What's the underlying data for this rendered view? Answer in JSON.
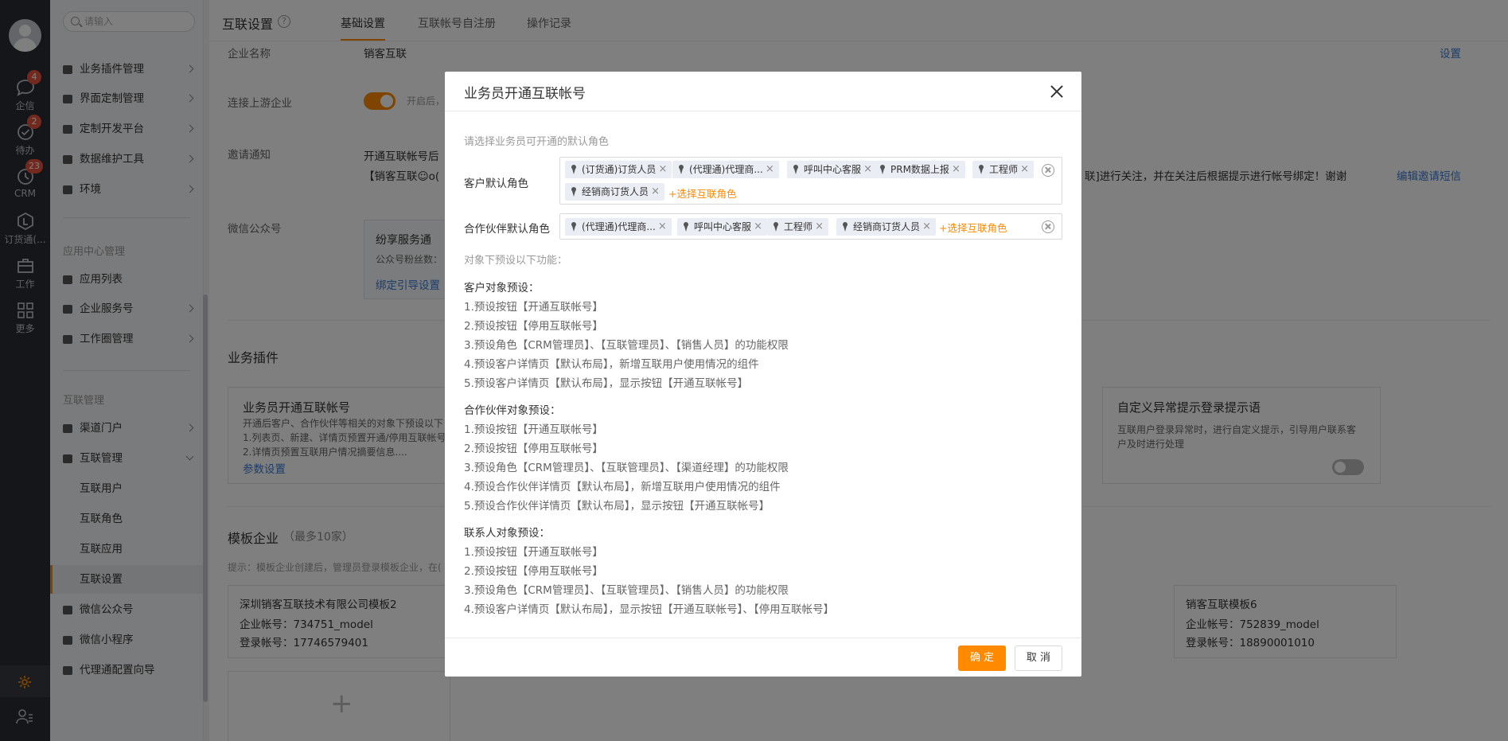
{
  "rail": {
    "items": [
      {
        "label": "企信",
        "badge": "4"
      },
      {
        "label": "待办",
        "badge": "2"
      },
      {
        "label": "CRM",
        "badge": "23"
      },
      {
        "label": "订货通(...",
        "badge": ""
      },
      {
        "label": "工作",
        "badge": ""
      },
      {
        "label": "更多",
        "badge": ""
      }
    ]
  },
  "sidebar": {
    "search_placeholder": "请输入",
    "items": [
      {
        "label": "业务插件管理"
      },
      {
        "label": "界面定制管理"
      },
      {
        "label": "定制开发平台"
      },
      {
        "label": "数据维护工具"
      },
      {
        "label": "环境"
      }
    ],
    "group_app": "应用中心管理",
    "app_items": [
      {
        "label": "应用列表"
      },
      {
        "label": "企业服务号"
      },
      {
        "label": "工作圈管理"
      }
    ],
    "group_interconnect": "互联管理",
    "ic_items": [
      {
        "label": "渠道门户"
      },
      {
        "label": "互联管理"
      }
    ],
    "ic_sub_items": [
      {
        "label": "互联用户"
      },
      {
        "label": "互联角色"
      },
      {
        "label": "互联应用"
      },
      {
        "label": "互联设置"
      }
    ],
    "bottom_items": [
      {
        "label": "微信公众号"
      },
      {
        "label": "微信小程序"
      },
      {
        "label": "代理通配置向导"
      }
    ]
  },
  "header": {
    "title": "互联设置",
    "tabs": [
      {
        "label": "基础设置"
      },
      {
        "label": "互联帐号自注册"
      },
      {
        "label": "操作记录"
      }
    ]
  },
  "main": {
    "company_name_label": "企业名称",
    "company_name_value": "销客互联",
    "set_link": "设置",
    "connect_label": "连接上游企业",
    "connect_hint": "开启后，",
    "invite_label": "邀请通知",
    "invite_line1": "开通互联帐号后",
    "invite_line2": "【销客互联☺o(",
    "invite_line2_tail": "联]进行关注，并在关注后根据提示进行帐号绑定！谢谢",
    "edit_sms_link": "编辑邀请短信",
    "wechat_label": "微信公众号",
    "wechat_card_title": "纷享服务通",
    "wechat_fans": "公众号粉丝数：",
    "bind_guide_link": "绑定引导设置",
    "plugins_title": "业务插件",
    "plugin1_title": "业务员开通互联帐号",
    "plugin1_desc1": "开通后客户、合作伙伴等相关的对象下预设以下",
    "plugin1_desc2": "1.列表页、新建、详情页预置开通/停用互联帐号",
    "plugin1_desc3": "2.详情页预置互联用户情况摘要信息....",
    "plugin1_link": "参数设置",
    "plugin2_title": "自定义异常提示登录提示语",
    "plugin2_desc1": "互联用户登录异常时，进行自定义提示，引导用户联系客",
    "plugin2_desc2": "户及时进行处理",
    "template_title": "模板企业",
    "template_max": "（最多10家）",
    "template_hint": "提示：模板企业创建后，管理员登录模板企业，在(",
    "tpl1_name": "深圳销客互联技术有限公司模板2",
    "tpl1_account": "企业帐号：734751_model",
    "tpl1_login": "登录帐号：17746579401",
    "tpl2_name": "销客互联模板6",
    "tpl2_account": "企业帐号：752839_model",
    "tpl2_login": "登录帐号：18890001010",
    "add_icon": "+"
  },
  "modal": {
    "title": "业务员开通互联帐号",
    "hint": "请选择业务员可开通的默认角色",
    "customer_label": "客户默认角色",
    "customer_tags": [
      "(订货通)订货人员",
      "(代理通)代理商...",
      "呼叫中心客服",
      "PRM数据上报",
      "工程师",
      "经销商订货人员"
    ],
    "partner_label": "合作伙伴默认角色",
    "partner_tags": [
      "(代理通)代理商...",
      "呼叫中心客服",
      "工程师",
      "经销商订货人员"
    ],
    "add_role": "+选择互联角色",
    "preset_hint": "对象下预设以下功能：",
    "sections": [
      {
        "title": "客户对象预设：",
        "lines": [
          "1.预设按钮【开通互联帐号】",
          "2.预设按钮【停用互联帐号】",
          "3.预设角色【CRM管理员】、【互联管理员】、【销售人员】的功能权限",
          "4.预设客户详情页【默认布局】，新增互联用户使用情况的组件",
          "5.预设客户详情页【默认布局】，显示按钮【开通互联帐号】"
        ]
      },
      {
        "title": "合作伙伴对象预设：",
        "lines": [
          "1.预设按钮【开通互联帐号】",
          "2.预设按钮【停用互联帐号】",
          "3.预设角色【CRM管理员】、【互联管理员】、【渠道经理】的功能权限",
          "4.预设合作伙伴详情页【默认布局】，新增互联用户使用情况的组件",
          "5.预设合作伙伴详情页【默认布局】，显示按钮【开通互联帐号】"
        ]
      },
      {
        "title": "联系人对象预设：",
        "lines": [
          "1.预设按钮【开通互联帐号】",
          "2.预设按钮【停用互联帐号】",
          "3.预设角色【CRM管理员】、【互联管理员】、【销售人员】的功能权限",
          "4.预设客户详情页【默认布局】，显示按钮【开通互联帐号】、【停用互联帐号】"
        ]
      }
    ],
    "ok": "确 定",
    "cancel": "取 消"
  }
}
